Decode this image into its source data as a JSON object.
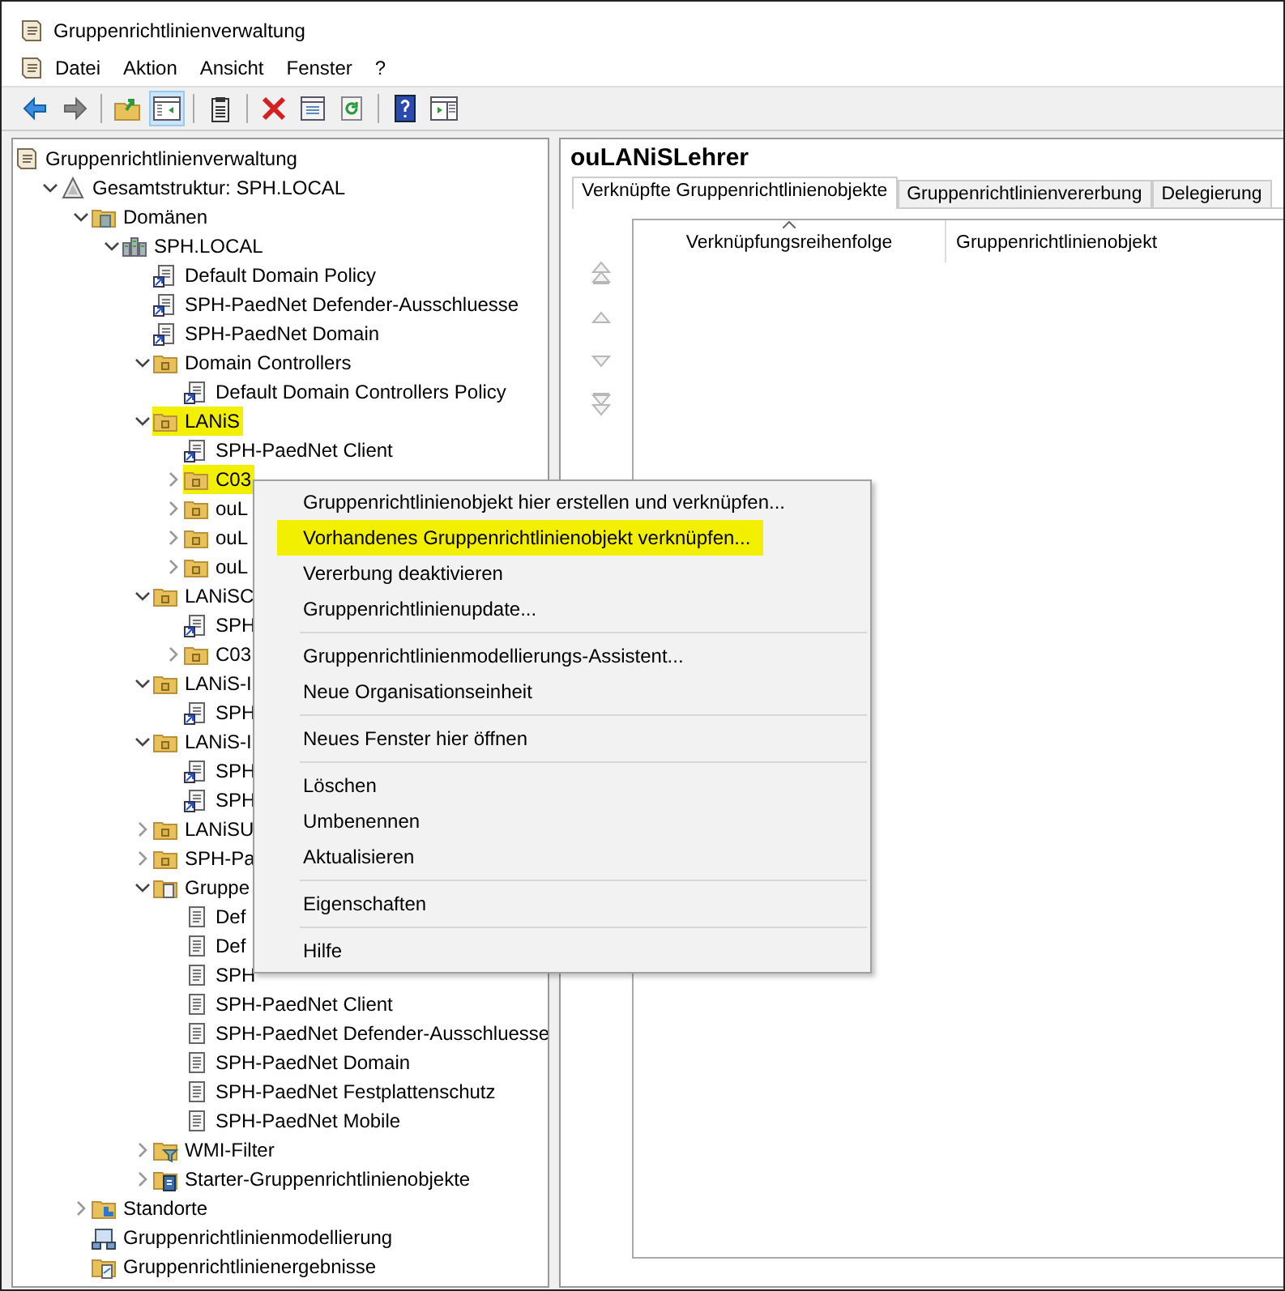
{
  "window": {
    "title": "Gruppenrichtlinienverwaltung"
  },
  "menu_bar": [
    "Datei",
    "Aktion",
    "Ansicht",
    "Fenster",
    "?"
  ],
  "toolbar": [
    [
      {
        "kind": "back",
        "pressed": false
      },
      {
        "kind": "forward",
        "pressed": false
      }
    ],
    [
      {
        "kind": "up",
        "pressed": false
      },
      {
        "kind": "tree",
        "pressed": true
      }
    ],
    [
      {
        "kind": "clipboard",
        "pressed": false
      }
    ],
    [
      {
        "kind": "delete",
        "pressed": false
      },
      {
        "kind": "properties",
        "pressed": false
      },
      {
        "kind": "refresh",
        "pressed": false
      }
    ],
    [
      {
        "kind": "help",
        "pressed": false
      },
      {
        "kind": "pane",
        "pressed": false
      }
    ]
  ],
  "tree": [
    {
      "label": "Gruppenrichtlinienverwaltung",
      "kind": "console",
      "highlighted": false,
      "children": [
        {
          "label": "Gesamtstruktur: SPH.LOCAL",
          "kind": "forest",
          "expanded": true,
          "highlighted": false,
          "children": [
            {
              "label": "Domänen",
              "kind": "domains",
              "expanded": true,
              "highlighted": false,
              "children": [
                {
                  "label": "SPH.LOCAL",
                  "kind": "domain",
                  "expanded": true,
                  "highlighted": false,
                  "children": [
                    {
                      "label": "Default Domain Policy",
                      "kind": "gpo-link",
                      "highlighted": false
                    },
                    {
                      "label": "SPH-PaedNet Defender-Ausschluesse",
                      "kind": "gpo-link",
                      "highlighted": false
                    },
                    {
                      "label": "SPH-PaedNet Domain",
                      "kind": "gpo-link",
                      "highlighted": false
                    },
                    {
                      "label": "Domain Controllers",
                      "kind": "ou",
                      "expanded": true,
                      "highlighted": false,
                      "children": [
                        {
                          "label": "Default Domain Controllers Policy",
                          "kind": "gpo-link",
                          "highlighted": false
                        }
                      ]
                    },
                    {
                      "label": "LANiS",
                      "kind": "ou",
                      "expanded": true,
                      "highlighted": true,
                      "children": [
                        {
                          "label": "SPH-PaedNet Client",
                          "kind": "gpo-link",
                          "highlighted": false
                        },
                        {
                          "label": "C03",
                          "kind": "ou",
                          "expanded": false,
                          "highlighted": true
                        },
                        {
                          "label": "ouL",
                          "kind": "ou",
                          "expanded": false,
                          "highlighted": false
                        },
                        {
                          "label": "ouL",
                          "kind": "ou",
                          "expanded": false,
                          "highlighted": false
                        },
                        {
                          "label": "ouL",
                          "kind": "ou",
                          "expanded": false,
                          "highlighted": false
                        }
                      ]
                    },
                    {
                      "label": "LANiSC",
                      "kind": "ou",
                      "expanded": true,
                      "highlighted": false,
                      "children": [
                        {
                          "label": "SPH",
                          "kind": "gpo-link",
                          "highlighted": false
                        },
                        {
                          "label": "C03",
                          "kind": "ou",
                          "expanded": false,
                          "highlighted": false
                        }
                      ]
                    },
                    {
                      "label": "LANiS-I",
                      "kind": "ou",
                      "expanded": true,
                      "highlighted": false,
                      "children": [
                        {
                          "label": "SPH",
                          "kind": "gpo-link",
                          "highlighted": false
                        }
                      ]
                    },
                    {
                      "label": "LANiS-I",
                      "kind": "ou",
                      "expanded": true,
                      "highlighted": false,
                      "children": [
                        {
                          "label": "SPH",
                          "kind": "gpo-link",
                          "highlighted": false
                        },
                        {
                          "label": "SPH",
                          "kind": "gpo-link",
                          "highlighted": false
                        }
                      ]
                    },
                    {
                      "label": "LANiSU",
                      "kind": "ou",
                      "expanded": false,
                      "highlighted": false
                    },
                    {
                      "label": "SPH-Pa",
                      "kind": "ou",
                      "expanded": false,
                      "highlighted": false
                    },
                    {
                      "label": "Gruppe",
                      "kind": "gpo-folder",
                      "expanded": true,
                      "highlighted": false,
                      "children": [
                        {
                          "label": "Def",
                          "kind": "gpo",
                          "highlighted": false
                        },
                        {
                          "label": "Def",
                          "kind": "gpo",
                          "highlighted": false
                        },
                        {
                          "label": "SPH",
                          "kind": "gpo",
                          "highlighted": false
                        },
                        {
                          "label": "SPH-PaedNet Client",
                          "kind": "gpo",
                          "highlighted": false
                        },
                        {
                          "label": "SPH-PaedNet Defender-Ausschluesse",
                          "kind": "gpo",
                          "highlighted": false
                        },
                        {
                          "label": "SPH-PaedNet Domain",
                          "kind": "gpo",
                          "highlighted": false
                        },
                        {
                          "label": "SPH-PaedNet Festplattenschutz",
                          "kind": "gpo",
                          "highlighted": false
                        },
                        {
                          "label": "SPH-PaedNet Mobile",
                          "kind": "gpo",
                          "highlighted": false
                        }
                      ]
                    },
                    {
                      "label": "WMI-Filter",
                      "kind": "filter-folder",
                      "expanded": false,
                      "highlighted": false
                    },
                    {
                      "label": "Starter-Gruppenrichtlinienobjekte",
                      "kind": "starter-folder",
                      "expanded": false,
                      "highlighted": false
                    }
                  ]
                }
              ]
            },
            {
              "label": "Standorte",
              "kind": "sites",
              "expanded": false,
              "highlighted": false
            },
            {
              "label": "Gruppenrichtlinienmodellierung",
              "kind": "modeling",
              "highlighted": false
            },
            {
              "label": "Gruppenrichtlinienergebnisse",
              "kind": "results",
              "highlighted": false
            }
          ]
        }
      ]
    }
  ],
  "context_menu": [
    [
      {
        "label": "Gruppenrichtlinienobjekt hier erstellen und verknüpfen...",
        "highlighted": false
      },
      {
        "label": "Vorhandenes Gruppenrichtlinienobjekt verknüpfen...",
        "highlighted": true
      },
      {
        "label": "Vererbung deaktivieren",
        "highlighted": false
      },
      {
        "label": "Gruppenrichtlinienupdate...",
        "highlighted": false
      }
    ],
    [
      {
        "label": "Gruppenrichtlinienmodellierungs-Assistent...",
        "highlighted": false
      },
      {
        "label": "Neue Organisationseinheit",
        "highlighted": false
      }
    ],
    [
      {
        "label": "Neues Fenster hier öffnen",
        "highlighted": false
      }
    ],
    [
      {
        "label": "Löschen",
        "highlighted": false
      },
      {
        "label": "Umbenennen",
        "highlighted": false
      },
      {
        "label": "Aktualisieren",
        "highlighted": false
      }
    ],
    [
      {
        "label": "Eigenschaften",
        "highlighted": false
      }
    ],
    [
      {
        "label": "Hilfe",
        "highlighted": false
      }
    ]
  ],
  "details": {
    "title": "ouLANiSLehrer",
    "tabs": [
      {
        "label": "Verknüpfte Gruppenrichtlinienobjekte",
        "selected": true
      },
      {
        "label": "Gruppenrichtlinienvererbung",
        "selected": false
      },
      {
        "label": "Delegierung",
        "selected": false
      }
    ],
    "order_buttons": [
      {
        "kind": "top",
        "disabled": true
      },
      {
        "kind": "up",
        "disabled": true
      },
      {
        "kind": "down",
        "disabled": true
      },
      {
        "kind": "bottom",
        "disabled": true
      }
    ],
    "columns": [
      {
        "label": "Verknüpfungsreihenfolge",
        "sorted": true
      },
      {
        "label": "Gruppenrichtlinienobjekt",
        "sorted": false
      }
    ]
  }
}
